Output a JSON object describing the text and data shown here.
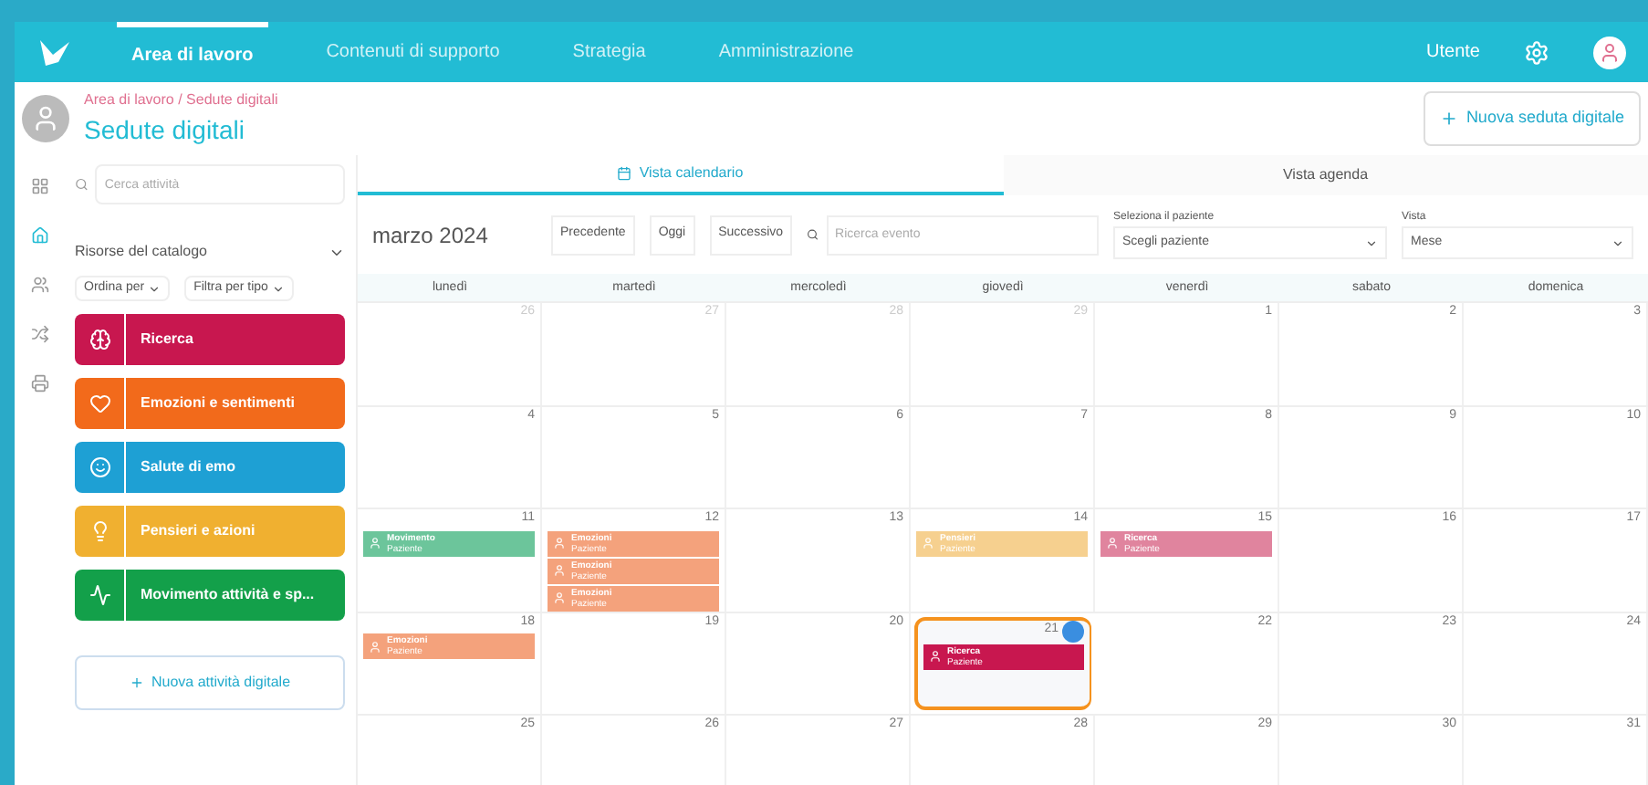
{
  "nav": {
    "items": [
      {
        "label": "Area di lavoro",
        "selected": true
      },
      {
        "label": "Contenuti di supporto",
        "selected": false
      },
      {
        "label": "Strategia",
        "selected": false
      },
      {
        "label": "Amministrazione",
        "selected": false
      }
    ],
    "user": "Utente"
  },
  "header": {
    "breadcrumb": "Area di lavoro / Sedute digitali",
    "title": "Sedute digitali",
    "action": "Nuova seduta digitale"
  },
  "rail": [
    {
      "selected": false
    },
    {
      "selected": true
    },
    {
      "selected": false
    },
    {
      "selected": false
    },
    {
      "selected": false
    }
  ],
  "catalog": {
    "search_placeholder": "Cerca attività",
    "title": "Risorse del catalogo",
    "filters": [
      "Ordina per",
      "Filtra per tipo"
    ],
    "resources": [
      {
        "label": "Ricerca",
        "color": "#c8174f"
      },
      {
        "label": "Emozioni e sentimenti",
        "color": "#f26a1b"
      },
      {
        "label": "Salute di emo",
        "color": "#1ea0d4"
      },
      {
        "label": "Pensieri e azioni",
        "color": "#f0b030"
      },
      {
        "label": "Movimento attività e sp...",
        "color": "#13a04a"
      }
    ],
    "add_button": "Nuova attività digitale"
  },
  "tabs": [
    {
      "label": "Vista calendario",
      "selected": true
    },
    {
      "label": "Vista agenda",
      "selected": false
    }
  ],
  "toolbar": {
    "month": "marzo 2024",
    "buttons": [
      "Precedente",
      "Oggi",
      "Successivo"
    ],
    "search_placeholder": "Ricerca evento",
    "patient": {
      "label": "Seleziona il paziente",
      "value": "Scegli paziente"
    },
    "view": {
      "label": "Vista",
      "value": "Mese"
    }
  },
  "weekdays": [
    "lunedì",
    "martedì",
    "mercoledì",
    "giovedì",
    "venerdì",
    "sabato",
    "domenica"
  ],
  "weeks": [
    [
      {
        "day": "26",
        "other": true
      },
      {
        "day": "27",
        "other": true
      },
      {
        "day": "28",
        "other": true
      },
      {
        "day": "29",
        "other": true
      },
      {
        "day": "1",
        "other": false
      },
      {
        "day": "2",
        "other": false
      },
      {
        "day": "3",
        "other": false
      }
    ],
    [
      {
        "day": "4",
        "other": false
      },
      {
        "day": "5",
        "other": false
      },
      {
        "day": "6",
        "other": false
      },
      {
        "day": "7",
        "other": false
      },
      {
        "day": "8",
        "other": false
      },
      {
        "day": "9",
        "other": false
      },
      {
        "day": "10",
        "other": false
      }
    ],
    [
      {
        "day": "11",
        "other": false,
        "events": [
          {
            "title": "Movimento",
            "subtitle": "Paziente",
            "color": "#6cc59b"
          }
        ]
      },
      {
        "day": "12",
        "other": false,
        "events": [
          {
            "title": "Emozioni",
            "subtitle": "Paziente",
            "color": "#f4a27c"
          },
          {
            "title": "Emozioni",
            "subtitle": "Paziente",
            "color": "#f4a27c"
          },
          {
            "title": "Emozioni",
            "subtitle": "Paziente",
            "color": "#f4a27c"
          }
        ]
      },
      {
        "day": "13",
        "other": false
      },
      {
        "day": "14",
        "other": false,
        "events": [
          {
            "title": "Pensieri",
            "subtitle": "Paziente",
            "color": "#f6d08f"
          }
        ]
      },
      {
        "day": "15",
        "other": false,
        "events": [
          {
            "title": "Ricerca",
            "subtitle": "Paziente",
            "color": "#e0849e"
          }
        ]
      },
      {
        "day": "16",
        "other": false
      },
      {
        "day": "17",
        "other": false
      }
    ],
    [
      {
        "day": "18",
        "other": false,
        "events": [
          {
            "title": "Emozioni",
            "subtitle": "Paziente",
            "color": "#f4a27c"
          }
        ]
      },
      {
        "day": "19",
        "other": false
      },
      {
        "day": "20",
        "other": false
      },
      {
        "day": "21",
        "other": false,
        "highlighted": true,
        "events": [
          {
            "title": "Ricerca",
            "subtitle": "Paziente",
            "color": "#c8174f"
          }
        ]
      },
      {
        "day": "22",
        "other": false
      },
      {
        "day": "23",
        "other": false
      },
      {
        "day": "24",
        "other": false
      }
    ],
    [
      {
        "day": "25",
        "other": false
      },
      {
        "day": "26",
        "other": false
      },
      {
        "day": "27",
        "other": false
      },
      {
        "day": "28",
        "other": false
      },
      {
        "day": "29",
        "other": false
      },
      {
        "day": "30",
        "other": false
      },
      {
        "day": "31",
        "other": false
      }
    ]
  ]
}
